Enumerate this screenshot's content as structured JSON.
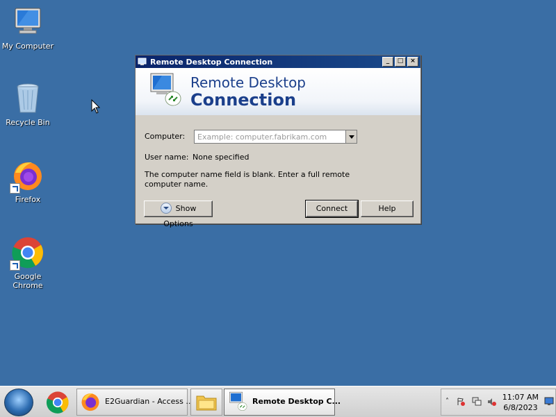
{
  "desktop": {
    "icons": [
      {
        "label": "My Computer",
        "icon": "computer-icon"
      },
      {
        "label": "Recycle Bin",
        "icon": "recycle-bin-icon"
      },
      {
        "label": "Firefox",
        "icon": "firefox-icon"
      },
      {
        "label": "Google Chrome",
        "icon": "chrome-icon"
      }
    ]
  },
  "dialog": {
    "title": "Remote Desktop Connection",
    "banner_line1": "Remote Desktop",
    "banner_line2": "Connection",
    "computer_label": "Computer:",
    "computer_placeholder": "Example: computer.fabrikam.com",
    "computer_value": "",
    "username_label": "User name:",
    "username_value": "None specified",
    "message": "The computer name field is blank. Enter a full remote computer name.",
    "show_options": "Show Options",
    "connect": "Connect",
    "help": "Help",
    "window_buttons": {
      "minimize": "_",
      "maximize": "□",
      "close": "×"
    }
  },
  "taskbar": {
    "items": [
      {
        "label": "",
        "icon": "chrome-icon"
      },
      {
        "label": "E2Guardian - Access ...",
        "icon": "firefox-icon"
      },
      {
        "label": "",
        "icon": "folder-icon"
      },
      {
        "label": "Remote Desktop C...",
        "icon": "remote-desktop-icon",
        "active": true
      }
    ],
    "clock_time": "11:07 AM",
    "clock_date": "6/8/2023"
  },
  "colors": {
    "desktop": "#3a6ea5",
    "title_accent": "#1b3f8b"
  }
}
